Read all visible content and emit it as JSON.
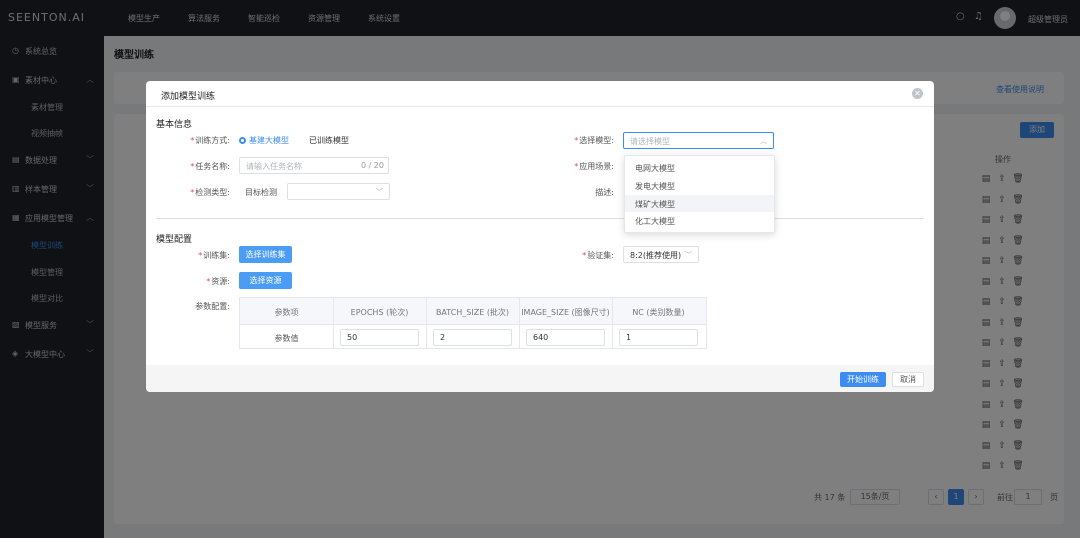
{
  "app": {
    "logo": "SEENTON.AI",
    "username": "超级管理员"
  },
  "topnav": [
    "模型生产",
    "算法服务",
    "智能巡检",
    "资源管理",
    "系统设置"
  ],
  "sidebar": {
    "items": [
      {
        "label": "系统总览",
        "icon": "clock-icon"
      },
      {
        "label": "素材中心",
        "icon": "folder-icon"
      },
      {
        "label": "数据处理",
        "icon": "data-icon"
      },
      {
        "label": "样本管理",
        "icon": "sample-icon"
      },
      {
        "label": "应用模型管理",
        "icon": "app-model-icon"
      },
      {
        "label": "模型服务",
        "icon": "service-icon"
      },
      {
        "label": "大模型中心",
        "icon": "bigmodel-icon"
      }
    ],
    "subs": [
      "素材管理",
      "视频抽帧",
      "模型训练",
      "模型管理",
      "模型对比"
    ]
  },
  "page": {
    "title": "模型训练",
    "guide_link": "查看使用说明",
    "add_button": "添加",
    "ops_header": "操作",
    "pagination": {
      "total": "共 17 条",
      "page_size": "15条/页",
      "current": "1",
      "goto_label": "前往",
      "goto_value": "1",
      "page_unit": "页"
    }
  },
  "modal": {
    "title": "添加模型训练",
    "basic_section": "基本信息",
    "train_mode_label": "训练方式:",
    "train_mode_options": [
      "基建大模型",
      "已训练模型"
    ],
    "model_label": "选择模型:",
    "model_placeholder": "请选择模型",
    "task_label": "任务名称:",
    "task_placeholder": "请输入任务名称",
    "task_count": "0 / 20",
    "scene_label": "应用场景:",
    "detect_label": "检测类型:",
    "detect_value": "目标检测",
    "desc_label": "描述:",
    "config_section": "模型配置",
    "train_set_label": "训练集:",
    "train_set_button": "选择训练集",
    "val_set_label": "验证集:",
    "val_set_value": "8:2(推荐使用)",
    "resource_label": "资源:",
    "resource_button": "选择资源",
    "params_label": "参数配置:",
    "param_headers": [
      "参数项",
      "EPOCHS (轮次)",
      "BATCH_SIZE (批次)",
      "IMAGE_SIZE (图像尺寸)",
      "NC (类别数量)"
    ],
    "param_row_label": "参数值",
    "param_values": [
      "50",
      "2",
      "640",
      "1"
    ],
    "start_button": "开始训练",
    "cancel_button": "取消",
    "model_options": [
      "电网大模型",
      "发电大模型",
      "煤矿大模型",
      "化工大模型"
    ]
  }
}
